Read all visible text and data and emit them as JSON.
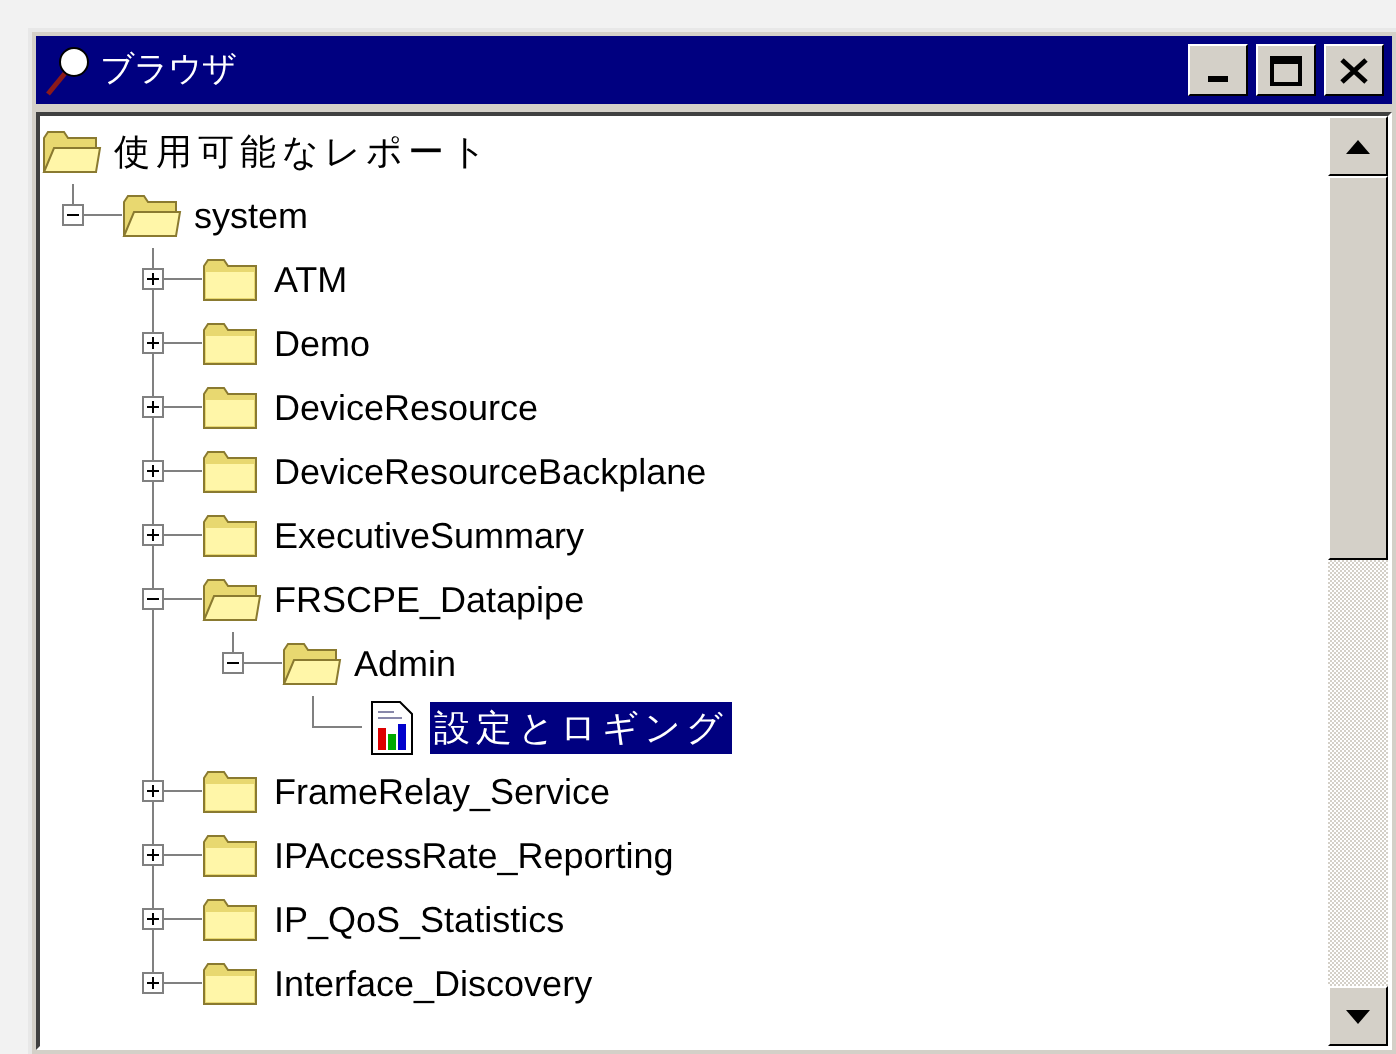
{
  "window": {
    "title": "ブラウザ"
  },
  "tree": {
    "label": "使用可能なレポート",
    "children": [
      {
        "label": "system",
        "kind": "folder",
        "expanded": true,
        "selected": false,
        "children": [
          {
            "label": "ATM",
            "kind": "folder",
            "expanded": false,
            "selected": false
          },
          {
            "label": "Demo",
            "kind": "folder",
            "expanded": false,
            "selected": false
          },
          {
            "label": "DeviceResource",
            "kind": "folder",
            "expanded": false,
            "selected": false
          },
          {
            "label": "DeviceResourceBackplane",
            "kind": "folder",
            "expanded": false,
            "selected": false
          },
          {
            "label": "ExecutiveSummary",
            "kind": "folder",
            "expanded": false,
            "selected": false
          },
          {
            "label": "FRSCPE_Datapipe",
            "kind": "folder",
            "expanded": true,
            "selected": false,
            "children": [
              {
                "label": "Admin",
                "kind": "folder",
                "expanded": true,
                "selected": false,
                "children": [
                  {
                    "label": "設定とロギング",
                    "kind": "report",
                    "selected": true
                  }
                ]
              }
            ]
          },
          {
            "label": "FrameRelay_Service",
            "kind": "folder",
            "expanded": false,
            "selected": false
          },
          {
            "label": "IPAccessRate_Reporting",
            "kind": "folder",
            "expanded": false,
            "selected": false
          },
          {
            "label": "IP_QoS_Statistics",
            "kind": "folder",
            "expanded": false,
            "selected": false
          },
          {
            "label": "Interface_Discovery",
            "kind": "folder",
            "expanded": false,
            "selected": false
          }
        ]
      }
    ]
  }
}
